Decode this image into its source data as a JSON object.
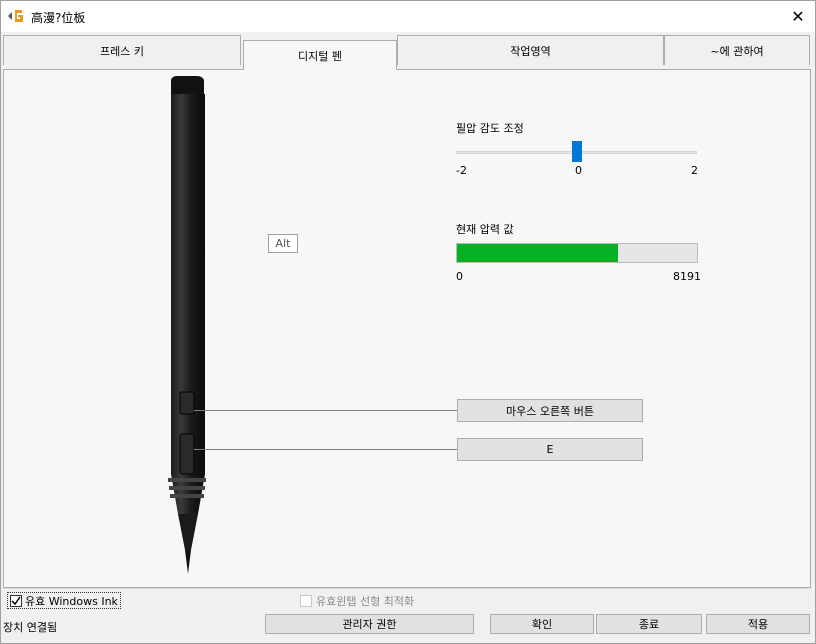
{
  "window": {
    "title": "高漫?位板",
    "close": "✕"
  },
  "tabs": [
    "프레스 키",
    "디지털 펜",
    "작업영역",
    "~에 관하여"
  ],
  "pressure_adjust": {
    "label": "필압 감도 조정",
    "min": "-2",
    "mid": "0",
    "max": "2",
    "value": 0
  },
  "current_pressure": {
    "label": "현재 압력 값",
    "min": "0",
    "max": "8191",
    "fill_fraction": 0.67
  },
  "pen": {
    "tip_label": "Alt",
    "upper_button": "마우스 오른쪽 버튼",
    "lower_button": "E"
  },
  "options": {
    "windows_ink": "유효 Windows Ink",
    "windows_ink_checked": true,
    "linear_opt": "유효윈탭 선형 최적화",
    "linear_opt_checked": false
  },
  "footer": {
    "status": "장치 연결됨",
    "admin": "관리자 권한",
    "ok": "확인",
    "exit": "종료",
    "apply": "적용"
  },
  "colors": {
    "accent": "#0078d7",
    "progress": "#06b025"
  }
}
